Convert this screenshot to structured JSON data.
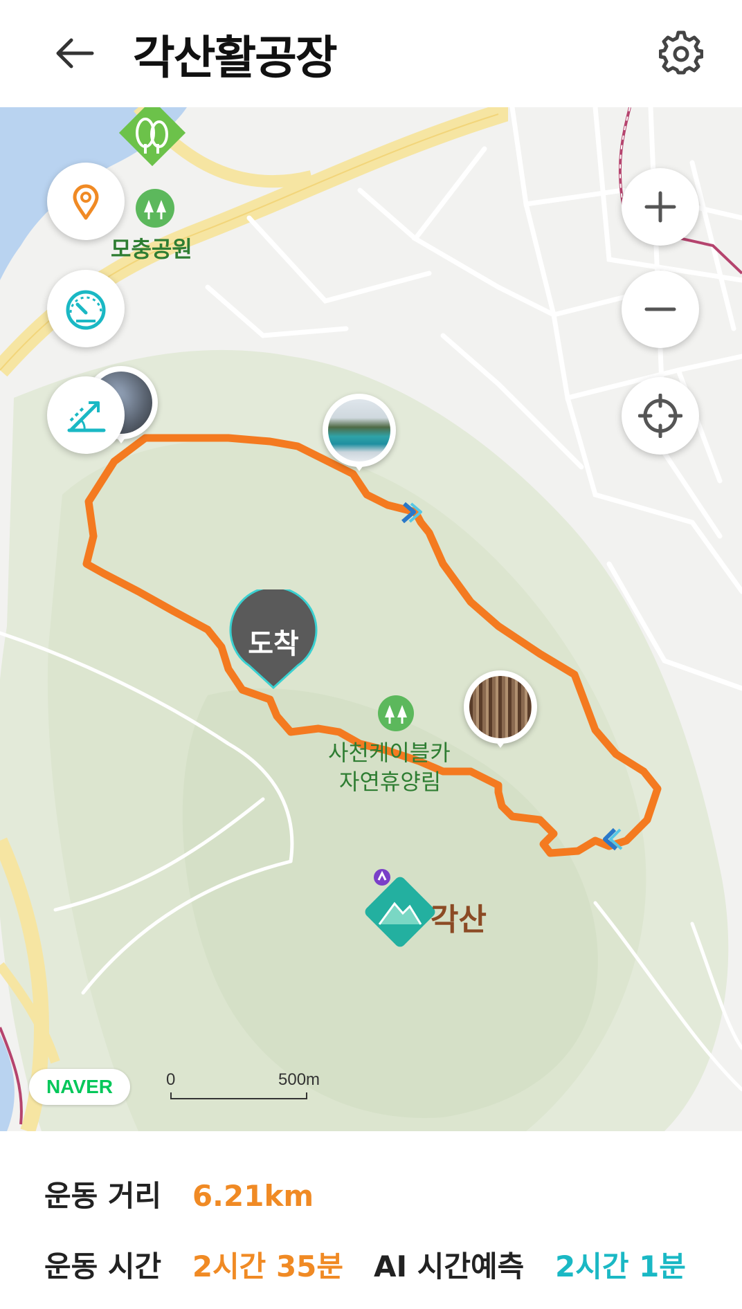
{
  "header": {
    "title": "각산활공장"
  },
  "map": {
    "places": {
      "park": "모충공원",
      "forest_line1": "사천케이블카",
      "forest_line2": "자연휴양림",
      "mountain": "각산"
    },
    "arrival_label": "도착",
    "logo": "NAVER",
    "scale": {
      "start": "0",
      "end": "500m"
    },
    "colors": {
      "route": "#f47a20",
      "accent_orange": "#f08a24",
      "accent_teal": "#1ab8c4",
      "park_green": "#5cb85c"
    }
  },
  "controls": {
    "left": [
      "location-pin-icon",
      "speedometer-icon",
      "elevation-slope-icon"
    ],
    "right": [
      "zoom-in-icon",
      "zoom-out-icon",
      "crosshair-icon"
    ]
  },
  "stats": {
    "distance_label": "운동 거리",
    "distance_value": "6.21km",
    "time_label": "운동 시간",
    "time_value": "2시간 35분",
    "ai_label": "AI 시간예측",
    "ai_value": "2시간 1분"
  }
}
